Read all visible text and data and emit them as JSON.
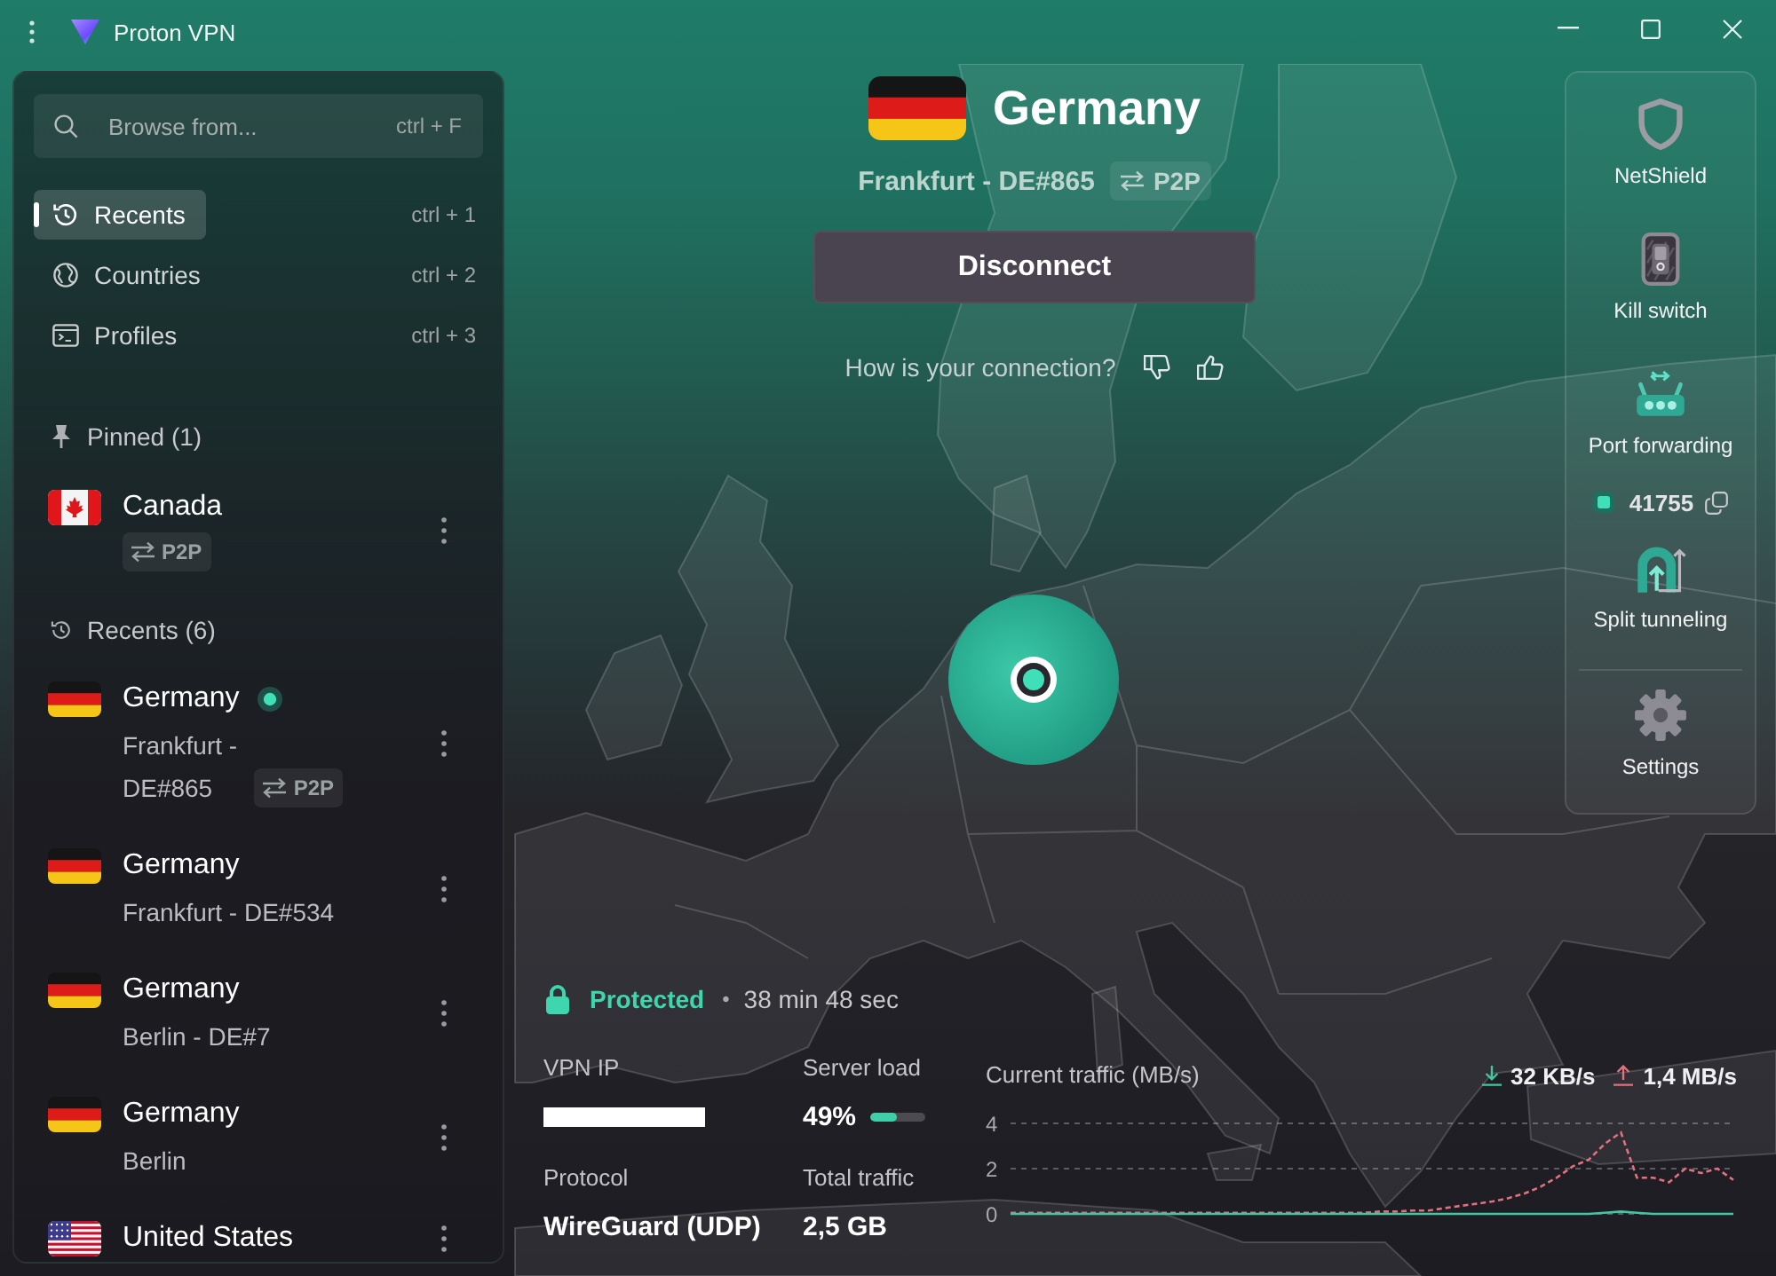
{
  "window": {
    "title": "Proton VPN"
  },
  "sidebar": {
    "search": {
      "placeholder": "Browse from...",
      "shortcut": "ctrl + F"
    },
    "nav": [
      {
        "kind": "recents",
        "label": "Recents",
        "shortcut": "ctrl + 1",
        "selected": true
      },
      {
        "kind": "countries",
        "label": "Countries",
        "shortcut": "ctrl + 2",
        "selected": false
      },
      {
        "kind": "profiles",
        "label": "Profiles",
        "shortcut": "ctrl + 3",
        "selected": false
      }
    ],
    "sections": [
      {
        "kind": "pinned",
        "title": "Pinned (1)",
        "items": [
          {
            "country": "Canada",
            "flag": {
              "kind": "ca"
            },
            "connected": false,
            "badge": "P2P"
          }
        ]
      },
      {
        "kind": "recents",
        "title": "Recents (6)",
        "items": [
          {
            "country": "Germany",
            "flag": {
              "kind": "de"
            },
            "connected": true,
            "server": "Frankfurt - DE#865",
            "badge": "P2P"
          },
          {
            "country": "Germany",
            "flag": {
              "kind": "de"
            },
            "connected": false,
            "server": "Frankfurt - DE#534"
          },
          {
            "country": "Germany",
            "flag": {
              "kind": "de"
            },
            "connected": false,
            "server": "Berlin - DE#7"
          },
          {
            "country": "Germany",
            "flag": {
              "kind": "de"
            },
            "connected": false,
            "server": "Berlin"
          },
          {
            "country": "United States",
            "flag": {
              "kind": "us"
            },
            "connected": false
          }
        ]
      }
    ]
  },
  "connection": {
    "country": "Germany",
    "flag": {
      "kind": "de"
    },
    "server": "Frankfurt - DE#865",
    "badge": "P2P",
    "action": "Disconnect",
    "feedback": "How is your connection?"
  },
  "features": {
    "items": [
      {
        "kind": "netshield",
        "label": "NetShield"
      },
      {
        "kind": "killswitch",
        "label": "Kill switch"
      },
      {
        "kind": "forwarding",
        "label": "Port forwarding",
        "port": "41755"
      },
      {
        "kind": "tunneling",
        "label": "Split tunneling"
      }
    ],
    "settings": "Settings"
  },
  "status": {
    "state": "Protected",
    "separator": "•",
    "duration": "38 min 48 sec"
  },
  "stats": {
    "vpn_ip": {
      "label": "VPN IP",
      "redacted": true
    },
    "server_load": {
      "label": "Server load",
      "value": "49%",
      "level": 0.49
    },
    "protocol": {
      "label": "Protocol",
      "value": "WireGuard (UDP)"
    },
    "total_traffic": {
      "label": "Total traffic",
      "value": "2,5 GB"
    }
  },
  "traffic": {
    "rates": [
      {
        "kind": "download",
        "value": "32 KB/s",
        "color": "#41c7a2"
      },
      {
        "kind": "upload",
        "value": "1,4 MB/s",
        "color": "#e2707f"
      }
    ],
    "chart_data": {
      "type": "line",
      "title": "Current traffic (MB/s)",
      "ylim": [
        0,
        4
      ],
      "yticks": [
        0,
        2,
        4
      ],
      "series": [
        {
          "color": "#e2707f",
          "line_style": "dashed",
          "values": [
            0.05,
            0.05,
            0.05,
            0.05,
            0.05,
            0.05,
            0.05,
            0.05,
            0.05,
            0.05,
            0.05,
            0.05,
            0.05,
            0.05,
            0.05,
            0.05,
            0.05,
            0.05,
            0.05,
            0.05,
            0.05,
            0.05,
            0.05,
            0.1,
            0.1,
            0.15,
            0.15,
            0.25,
            0.35,
            0.45,
            0.55,
            0.7,
            0.9,
            1.2,
            1.6,
            2.1,
            2.4,
            3.1,
            3.6,
            1.6,
            1.6,
            1.4,
            2.0,
            1.8,
            2.0,
            1.5
          ]
        },
        {
          "color": "#41c7a2",
          "line_style": "solid",
          "values": [
            0,
            0,
            0,
            0,
            0,
            0,
            0,
            0,
            0,
            0,
            0,
            0,
            0,
            0,
            0,
            0,
            0,
            0,
            0,
            0,
            0,
            0,
            0,
            0,
            0,
            0,
            0,
            0,
            0,
            0,
            0,
            0,
            0,
            0,
            0,
            0,
            0,
            0.05,
            0.1,
            0.05,
            0,
            0,
            0,
            0,
            0,
            0
          ]
        }
      ]
    }
  }
}
